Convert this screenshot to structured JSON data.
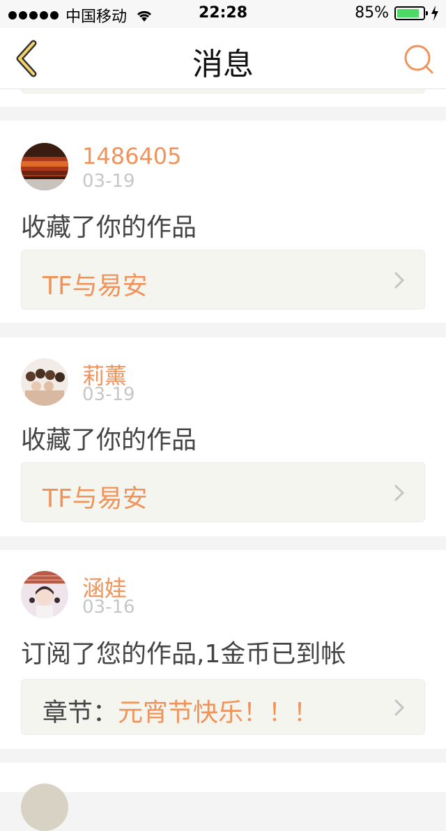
{
  "status_bar": {
    "carrier": "中国移动",
    "time": "22:28",
    "battery_percent": "85%",
    "battery_level": 0.85
  },
  "nav": {
    "title": "消息",
    "back_icon": "chevron-left-icon",
    "search_icon": "search-icon"
  },
  "messages": [
    {
      "username": "1486405",
      "date": "03-19",
      "text": "收藏了你的作品",
      "work_prefix": "",
      "work_title": "TF与易安"
    },
    {
      "username": "莉薰",
      "date": "03-19",
      "text": "收藏了你的作品",
      "work_prefix": "",
      "work_title": "TF与易安"
    },
    {
      "username": "涵娃",
      "date": "03-16",
      "text": "订阅了您的作品,1金币已到帐",
      "work_prefix": "章节：",
      "work_title": "元宵节快乐！！！"
    }
  ],
  "colors": {
    "accent": "#f0935a",
    "date_gray": "#c6c6c6",
    "box_bg": "#f5f5ef",
    "nav_accent": "#f5d26a"
  }
}
